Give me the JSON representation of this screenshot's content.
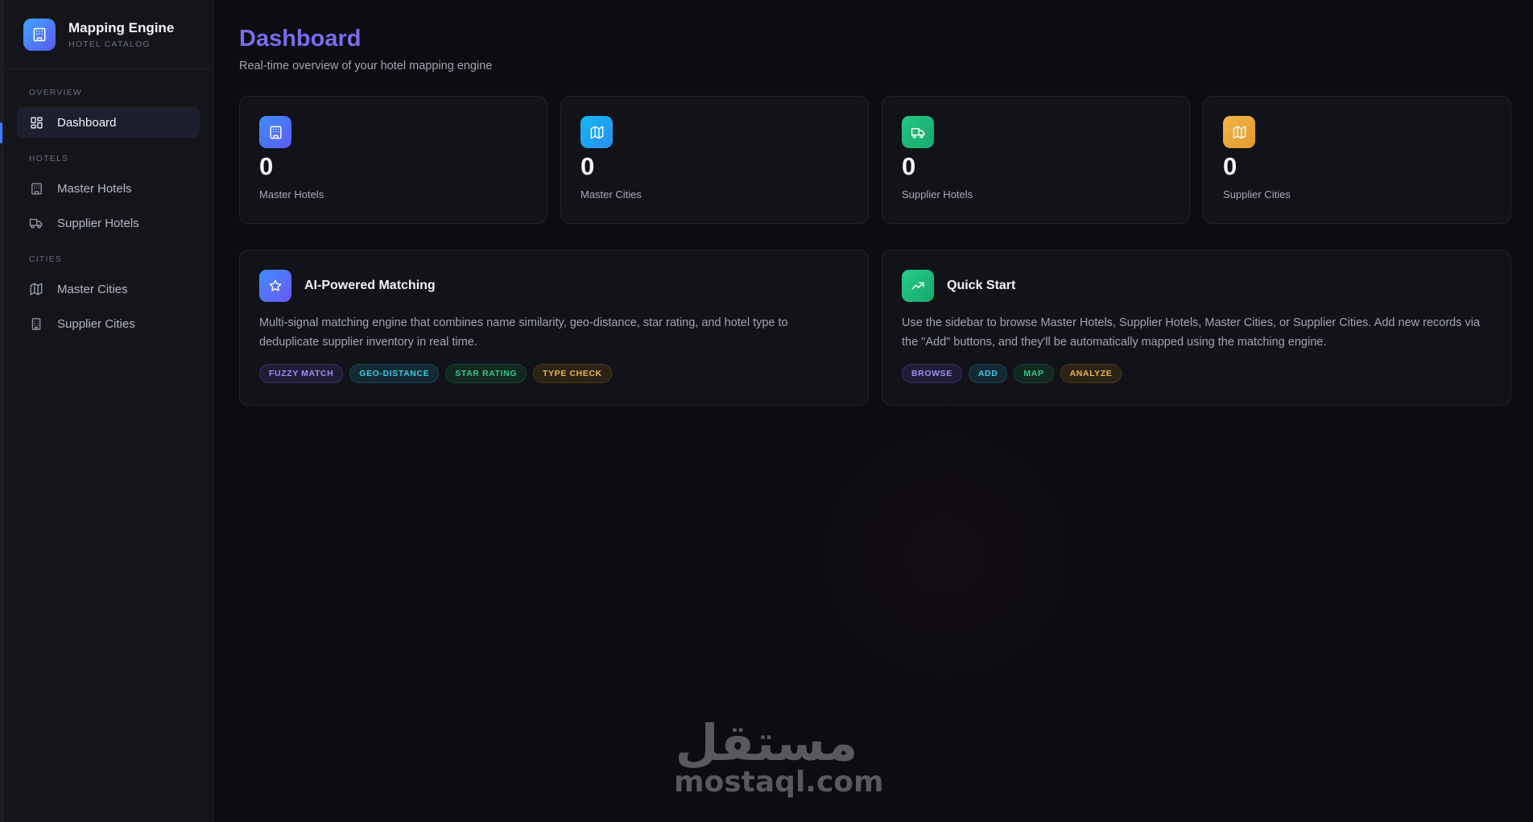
{
  "brand": {
    "title": "Mapping Engine",
    "subtitle": "HOTEL CATALOG",
    "icon": "building-icon"
  },
  "sidebar": {
    "sections": {
      "overview": "OVERVIEW",
      "hotels": "HOTELS",
      "cities": "CITIES"
    },
    "items": [
      {
        "label": "Dashboard",
        "icon": "dashboard-grid-icon",
        "active": true
      },
      {
        "label": "Master Hotels",
        "icon": "building-icon"
      },
      {
        "label": "Supplier Hotels",
        "icon": "truck-icon"
      },
      {
        "label": "Master Cities",
        "icon": "map-icon"
      },
      {
        "label": "Supplier Cities",
        "icon": "city-building-icon"
      }
    ]
  },
  "page": {
    "title": "Dashboard",
    "subtitle": "Real-time overview of your hotel mapping engine"
  },
  "stats": [
    {
      "value": "0",
      "label": "Master Hotels",
      "icon": "building-icon",
      "color": "#4f7cf6"
    },
    {
      "value": "0",
      "label": "Master Cities",
      "icon": "map-icon",
      "color": "#1ea7e8"
    },
    {
      "value": "0",
      "label": "Supplier Hotels",
      "icon": "truck-icon",
      "color": "#22c07a"
    },
    {
      "value": "0",
      "label": "Supplier Cities",
      "icon": "map-icon",
      "color": "#e8a93c"
    }
  ],
  "features": [
    {
      "title": "AI-Powered Matching",
      "icon": "star-icon",
      "description": "Multi-signal matching engine that combines name similarity, geo-distance, star rating, and hotel type to deduplicate supplier inventory in real time.",
      "tags": [
        "FUZZY MATCH",
        "GEO-DISTANCE",
        "STAR RATING",
        "TYPE CHECK"
      ]
    },
    {
      "title": "Quick Start",
      "icon": "trending-up-icon",
      "description": "Use the sidebar to browse Master Hotels, Supplier Hotels, Master Cities, or Supplier Cities. Add new records via the \"Add\" buttons, and they'll be automatically mapped using the matching engine.",
      "tags": [
        "BROWSE",
        "ADD",
        "MAP",
        "ANALYZE"
      ]
    }
  ],
  "watermark": {
    "arabic": "مستقل",
    "latin": "mostaql.com"
  },
  "colors": {
    "accent": "#7b6cf0",
    "active_marker": "#3b7bff",
    "background": "#0c0c11",
    "sidebar": "#14151b"
  }
}
